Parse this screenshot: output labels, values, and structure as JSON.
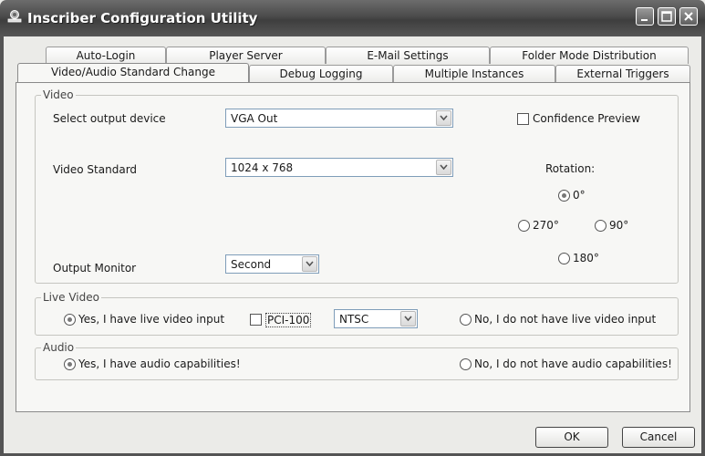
{
  "window": {
    "title": "Inscriber Configuration Utility",
    "icon": "app-icon",
    "controls": [
      "minimize-icon",
      "maximize-icon",
      "close-icon"
    ]
  },
  "tabs": {
    "row1": [
      "Auto-Login",
      "Player Server",
      "E-Mail Settings",
      "Folder Mode Distribution"
    ],
    "row2": [
      "Video/Audio Standard Change",
      "Debug Logging",
      "Multiple Instances",
      "External Triggers"
    ],
    "active": "Video/Audio Standard Change"
  },
  "video": {
    "group_label": "Video",
    "output_device_label": "Select output device",
    "output_device_value": "VGA Out",
    "confidence_preview_label": "Confidence Preview",
    "confidence_preview_checked": false,
    "standard_label": "Video Standard",
    "standard_value": "1024 x 768",
    "monitor_label": "Output Monitor",
    "monitor_value": "Second",
    "rotation_label": "Rotation:",
    "rotation_options": {
      "r0": "0°",
      "r270": "270°",
      "r90": "90°",
      "r180": "180°"
    },
    "rotation_selected": "0°"
  },
  "live_video": {
    "group_label": "Live Video",
    "yes_label": "Yes, I have live video input",
    "yes_selected": true,
    "pci_label": "PCI-100",
    "pci_checked": false,
    "format_value": "NTSC",
    "no_label": "No, I do not have live video input"
  },
  "audio": {
    "group_label": "Audio",
    "yes_label": "Yes, I have audio capabilities!",
    "yes_selected": true,
    "no_label": "No, I do not have audio capabilities!"
  },
  "buttons": {
    "ok": "OK",
    "cancel": "Cancel"
  }
}
